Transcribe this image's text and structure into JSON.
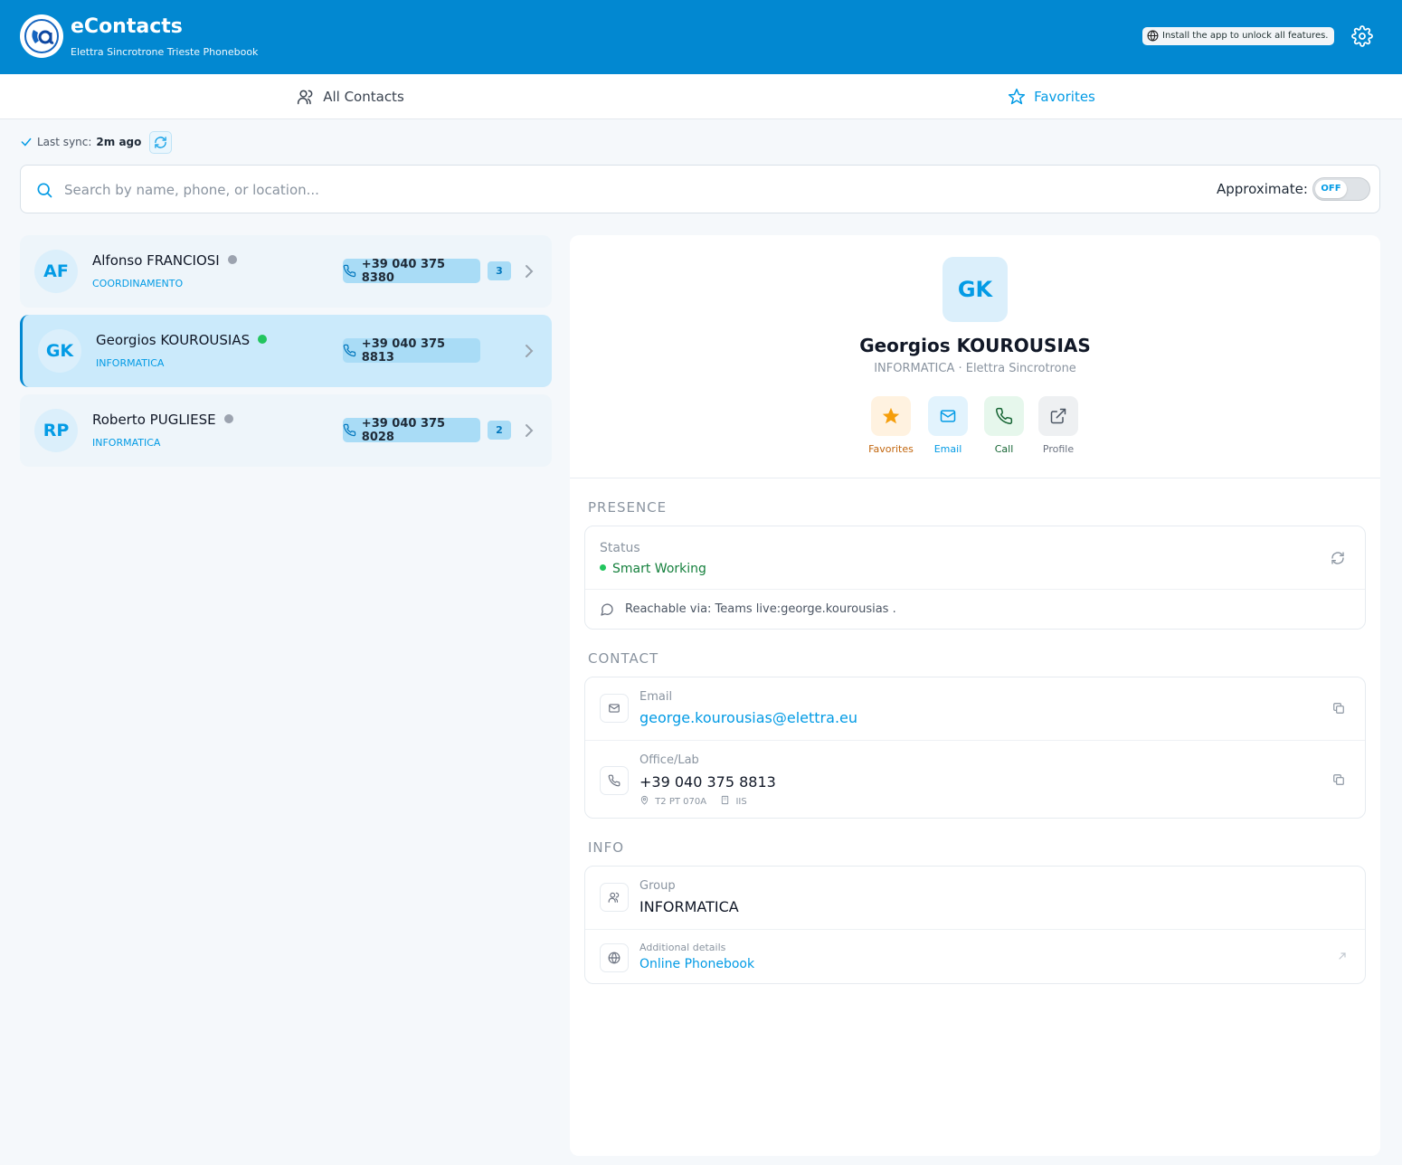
{
  "header": {
    "app_title": "eContacts",
    "app_subtitle": "Elettra Sincrotrone Trieste Phonebook",
    "install_text": "Install the app to unlock all features.",
    "brand_color": "#0288d1"
  },
  "tabs": [
    {
      "label": "All Contacts",
      "icon": "users-icon",
      "active": false
    },
    {
      "label": "Favorites",
      "icon": "star-icon",
      "active": true
    }
  ],
  "sync": {
    "label": "Last sync:",
    "value": "2m ago"
  },
  "search": {
    "placeholder": "Search by name, phone, or location...",
    "value": "",
    "approximate_label": "Approximate:",
    "approximate_state": "OFF"
  },
  "contacts": [
    {
      "initials": "AF",
      "name": "Alfonso FRANCIOSI",
      "department": "COORDINAMENTO",
      "status": "offline",
      "phone": "+39 040 375 8380",
      "count": "3",
      "selected": false
    },
    {
      "initials": "GK",
      "name": "Georgios KOUROUSIAS",
      "department": "INFORMATICA",
      "status": "online",
      "phone": "+39 040 375 8813",
      "count": "",
      "selected": true
    },
    {
      "initials": "RP",
      "name": "Roberto PUGLIESE",
      "department": "INFORMATICA",
      "status": "offline",
      "phone": "+39 040 375 8028",
      "count": "2",
      "selected": false
    }
  ],
  "detail": {
    "initials": "GK",
    "name": "Georgios KOUROUSIAS",
    "subtitle": "INFORMATICA · Elettra Sincrotrone",
    "actions": {
      "favorites": "Favorites",
      "email": "Email",
      "call": "Call",
      "profile": "Profile"
    },
    "presence": {
      "title": "PRESENCE",
      "status_label": "Status",
      "status_value": "Smart Working",
      "status_color": "#22c55e",
      "reachable": "Reachable via: Teams live:george.kourousias ."
    },
    "contact": {
      "title": "CONTACT",
      "email_label": "Email",
      "email_value": "george.kourousias@elettra.eu",
      "office_label": "Office/Lab",
      "office_phone": "+39 040 375 8813",
      "location": "T2 PT 070A",
      "building": "IIS"
    },
    "info": {
      "title": "INFO",
      "group_label": "Group",
      "group_value": "INFORMATICA",
      "additional_label": "Additional details",
      "additional_link": "Online Phonebook"
    }
  }
}
